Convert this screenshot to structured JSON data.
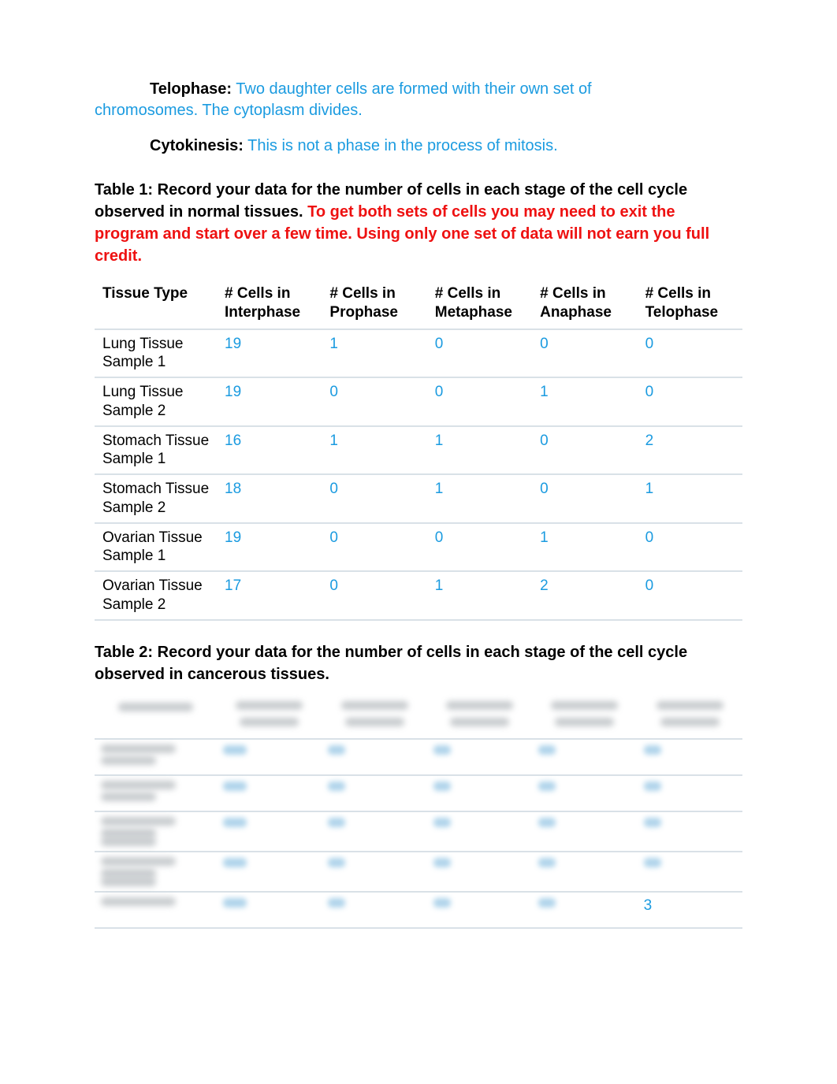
{
  "definitions": {
    "telophase_label": "Telophase:",
    "telophase_text_line1": " Two daughter cells are formed with their own set of",
    "telophase_text_line2": "chromosomes. The cytoplasm divides.",
    "cytokinesis_label": "Cytokinesis:",
    "cytokinesis_text": " This is not a phase in the process of mitosis."
  },
  "table1": {
    "intro_black": "Table 1:  Record your data for the number of cells in each stage of the cell cycle observed in normal tissues.  ",
    "intro_red": "To get both sets of cells you may need to exit the program and start over a few time.  Using only one set of data will not earn you full credit.",
    "headers": {
      "c0": "Tissue Type",
      "c1": "# Cells in Interphase",
      "c2": "# Cells in Prophase",
      "c3": "# Cells in Metaphase",
      "c4": "# Cells in Anaphase",
      "c5": "# Cells in Telophase"
    },
    "rows": [
      {
        "tissue": "Lung Tissue Sample 1",
        "v": [
          "19",
          "1",
          "0",
          "0",
          "0"
        ]
      },
      {
        "tissue": "Lung Tissue Sample 2",
        "v": [
          "19",
          "0",
          "0",
          "1",
          "0"
        ]
      },
      {
        "tissue": "Stomach Tissue Sample 1",
        "v": [
          "16",
          "1",
          "1",
          "0",
          "2"
        ]
      },
      {
        "tissue": "Stomach Tissue Sample 2",
        "v": [
          "18",
          "0",
          "1",
          "0",
          "1"
        ]
      },
      {
        "tissue": "Ovarian Tissue Sample 1",
        "v": [
          "19",
          "0",
          "0",
          "1",
          "0"
        ]
      },
      {
        "tissue": "Ovarian Tissue Sample 2",
        "v": [
          "17",
          "0",
          "1",
          "2",
          "0"
        ]
      }
    ]
  },
  "table2": {
    "intro": "Table 2:  Record your data for the number of cells in each stage of the cell cycle observed in cancerous tissues.",
    "visible_value": "3"
  },
  "chart_data": {
    "type": "table",
    "title": "Table 1: Number of cells in each stage of the cell cycle observed in normal tissues",
    "columns": [
      "Tissue Type",
      "# Cells in Interphase",
      "# Cells in Prophase",
      "# Cells in Metaphase",
      "# Cells in Anaphase",
      "# Cells in Telophase"
    ],
    "rows": [
      [
        "Lung Tissue Sample 1",
        19,
        1,
        0,
        0,
        0
      ],
      [
        "Lung Tissue Sample 2",
        19,
        0,
        0,
        1,
        0
      ],
      [
        "Stomach Tissue Sample 1",
        16,
        1,
        1,
        0,
        2
      ],
      [
        "Stomach Tissue Sample 2",
        18,
        0,
        1,
        0,
        1
      ],
      [
        "Ovarian Tissue Sample 1",
        19,
        0,
        0,
        1,
        0
      ],
      [
        "Ovarian Tissue Sample 2",
        17,
        0,
        1,
        2,
        0
      ]
    ]
  }
}
